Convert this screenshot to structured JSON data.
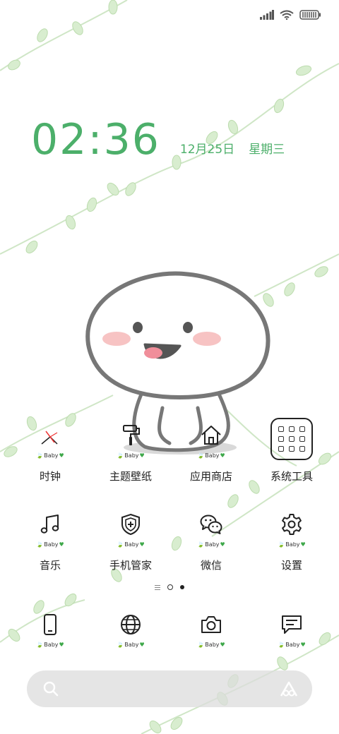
{
  "status_bar": {
    "icons": [
      "signal-icon",
      "wifi-icon",
      "battery-icon"
    ]
  },
  "lockscreen": {
    "time": "02:36",
    "date": "12月25日",
    "weekday": "星期三",
    "accent_color": "#4caf6a"
  },
  "icon_badge": "Baby",
  "apps_row1": [
    {
      "label": "时钟",
      "icon": "clock-icon"
    },
    {
      "label": "主题壁纸",
      "icon": "paint-roller-icon"
    },
    {
      "label": "应用商店",
      "icon": "store-icon"
    },
    {
      "label": "系统工具",
      "icon": "tools-folder-icon"
    }
  ],
  "apps_row2": [
    {
      "label": "音乐",
      "icon": "music-icon"
    },
    {
      "label": "手机管家",
      "icon": "shield-icon"
    },
    {
      "label": "微信",
      "icon": "wechat-icon"
    },
    {
      "label": "设置",
      "icon": "gear-icon"
    }
  ],
  "dock": [
    {
      "icon": "phone-icon"
    },
    {
      "icon": "browser-icon"
    },
    {
      "icon": "camera-icon"
    },
    {
      "icon": "message-icon"
    }
  ],
  "search": {
    "icons": [
      "search-icon",
      "assistant-icon"
    ]
  }
}
